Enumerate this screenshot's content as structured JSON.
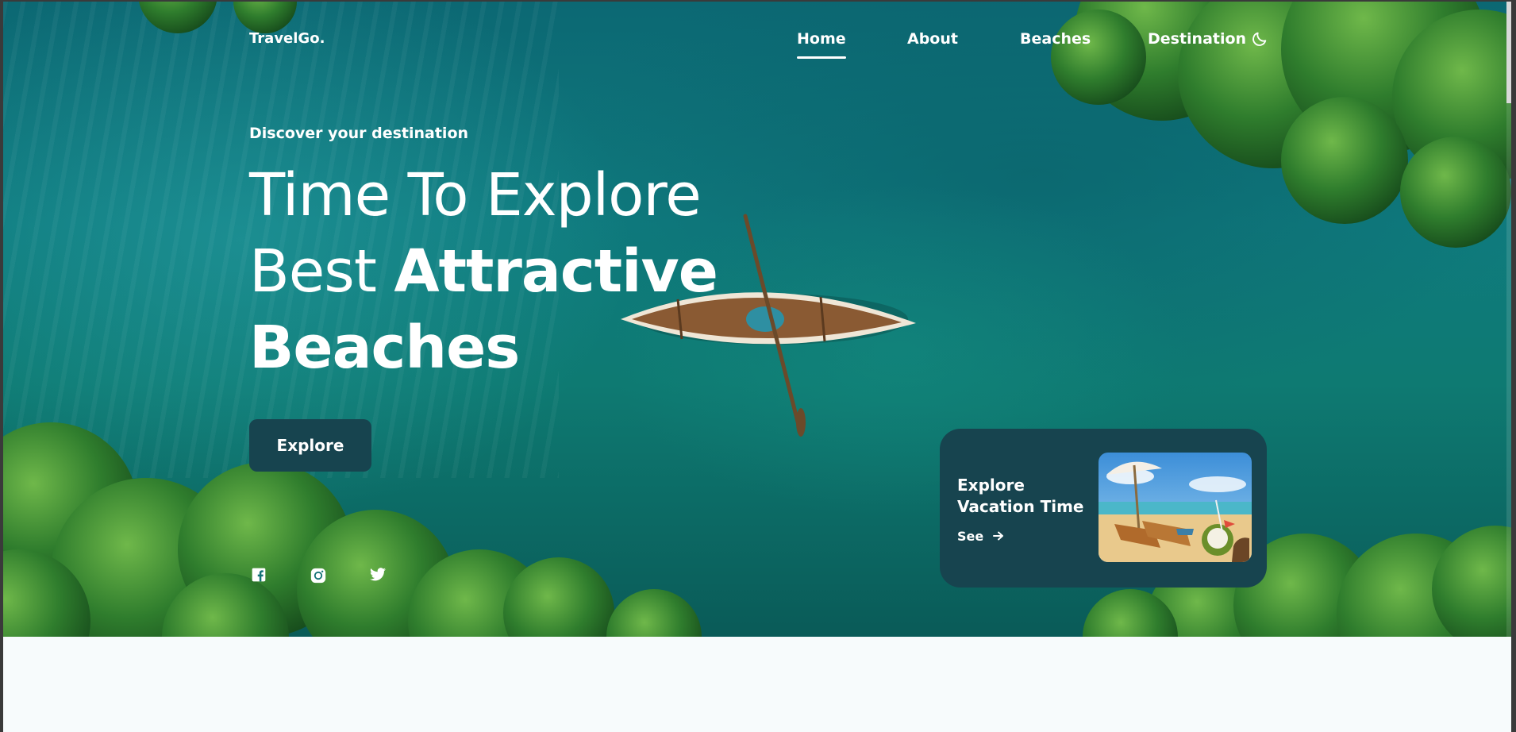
{
  "nav": {
    "logo": "TravelGo.",
    "links": [
      {
        "label": "Home",
        "active": true
      },
      {
        "label": "About",
        "active": false
      },
      {
        "label": "Beaches",
        "active": false
      },
      {
        "label": "Destination",
        "active": false
      }
    ],
    "theme_toggle_icon": "moon-icon"
  },
  "hero": {
    "subtitle": "Discover your destination",
    "headline_line1": "Time To Explore",
    "headline_line2_light": "Best",
    "headline_line2_bold": "Attractive",
    "headline_line3_bold": "Beaches",
    "button_label": "Explore",
    "social_icons": [
      "facebook-icon",
      "instagram-icon",
      "twitter-icon"
    ]
  },
  "card": {
    "title_line1": "Explore",
    "title_line2": "Vacation Time",
    "link_label": "See",
    "link_icon": "arrow-right-icon",
    "image": "beach-vacation-image"
  },
  "colors": {
    "accent": "#17444f",
    "page_background": "#f7fbfc"
  }
}
